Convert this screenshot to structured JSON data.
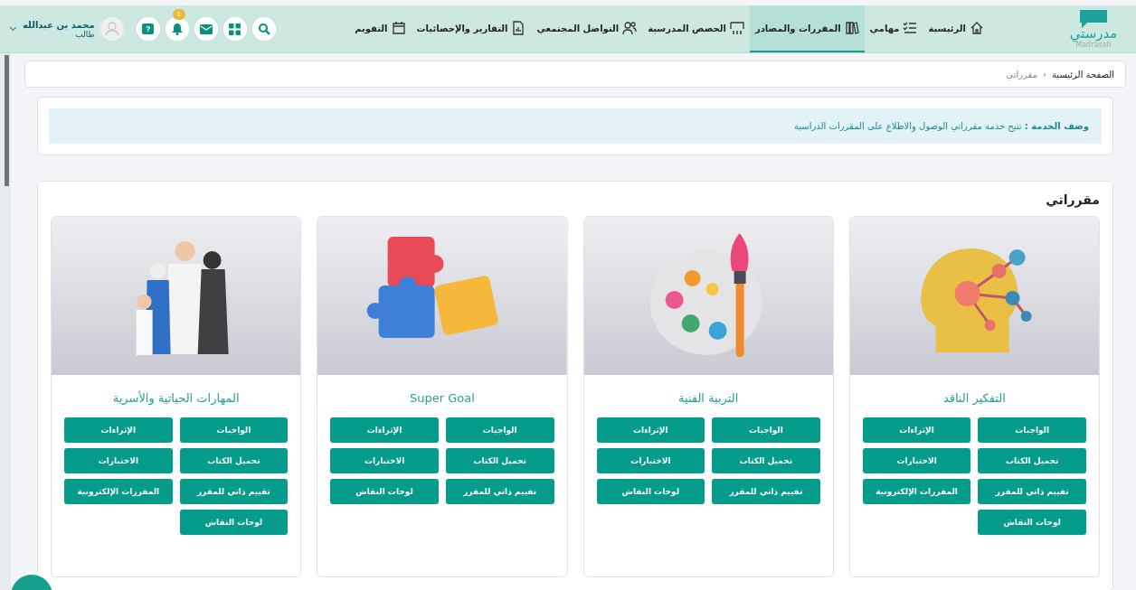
{
  "logo": {
    "name": "مدرستي",
    "latin": "Madrasati"
  },
  "nav": [
    {
      "label": "الرئيسية",
      "selected": false
    },
    {
      "label": "مهامي",
      "selected": false
    },
    {
      "label": "المقررات والمصادر",
      "selected": true
    },
    {
      "label": "الحصص المدرسية",
      "selected": false
    },
    {
      "label": "التواصل المجتمعي",
      "selected": false
    },
    {
      "label": "التقارير والإحصائيات",
      "selected": false
    },
    {
      "label": "التقويم",
      "selected": false
    }
  ],
  "toolbar": {
    "notification_count": "1",
    "help_glyph": "?"
  },
  "user": {
    "name": "محمد بن عبدالله",
    "role": "طالب"
  },
  "breadcrumb": {
    "items": [
      "الصفحة الرئيسية",
      "مقرراتي"
    ],
    "separator": "›"
  },
  "service_description": "**وصف الخدمة :** تتيح خدمة مقرراتي الوصول والاطلاع على المقررات الدراسية",
  "section_title": "مقرراتي",
  "courses": [
    {
      "title": "التفكير الناقد",
      "picture": {
        "kind": "picture"
      },
      "buttons": [
        "الواجبات",
        "الإثراءات",
        "تحميل الكتاب",
        "الاختبارات",
        "تقييم ذاتي للمقرر",
        "المقررات الإلكترونية",
        "لوحات النقاش"
      ]
    },
    {
      "title": "التربية الفنية",
      "picture": {
        "kind": "picture"
      },
      "buttons": [
        "الواجبات",
        "الإثراءات",
        "تحميل الكتاب",
        "الاختبارات",
        "تقييم ذاتي للمقرر",
        "لوحات النقاش"
      ]
    },
    {
      "title": "Super Goal",
      "picture": {
        "kind": "picture"
      },
      "buttons": [
        "الواجبات",
        "الإثراءات",
        "تحميل الكتاب",
        "الاختبارات",
        "تقييم ذاتي للمقرر",
        "لوحات النقاش"
      ]
    },
    {
      "title": "المهارات الحياتية والأسرية",
      "picture": {
        "kind": "picture"
      },
      "buttons": [
        "الواجبات",
        "الإثراءات",
        "تحميل الكتاب",
        "الاختبارات",
        "تقييم ذاتي للمقرر",
        "المقررات الإلكترونية",
        "لوحات النقاش"
      ]
    }
  ]
}
